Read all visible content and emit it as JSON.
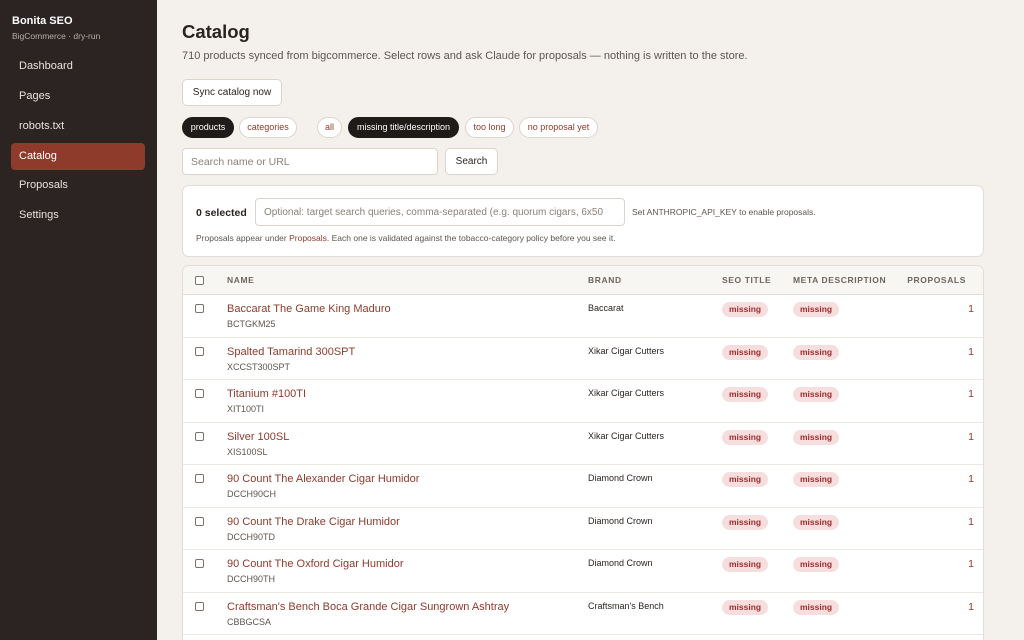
{
  "sidebar": {
    "brand": "Bonita SEO",
    "subtitle": "BigCommerce · dry-run",
    "items": [
      {
        "label": "Dashboard"
      },
      {
        "label": "Pages"
      },
      {
        "label": "robots.txt"
      },
      {
        "label": "Catalog",
        "active": true
      },
      {
        "label": "Proposals"
      },
      {
        "label": "Settings"
      }
    ]
  },
  "main": {
    "title": "Catalog",
    "description": "710 products synced from bigcommerce. Select rows and ask Claude for proposals — nothing is written to the store.",
    "sync_label": "Sync catalog now",
    "chips": [
      {
        "label": "products",
        "active": true
      },
      {
        "label": "categories",
        "active": false
      },
      {
        "label": "all",
        "active": false
      },
      {
        "label": "missing title/description",
        "active": true
      },
      {
        "label": "too long",
        "active": false
      },
      {
        "label": "no proposal yet",
        "active": false
      }
    ],
    "search_placeholder": "Search name or URL",
    "search_label": "Search"
  },
  "panel": {
    "selected": "0 selected",
    "queries_placeholder": "Optional: target search queries, comma-separated (e.g. quorum cigars, 6x50",
    "api_note": "Set ANTHROPIC_API_KEY to enable proposals.",
    "note_prefix": "Proposals appear under ",
    "note_link": "Proposals",
    "note_suffix": ". Each one is validated against the tobacco-category policy before you see it."
  },
  "table": {
    "headers": {
      "name": "NAME",
      "brand": "BRAND",
      "seo": "SEO TITLE",
      "meta": "META DESCRIPTION",
      "proposals": "PROPOSALS"
    },
    "rows": [
      {
        "name": "Baccarat The Game King Maduro",
        "sku": "BCTGKM25",
        "brand": "Baccarat",
        "seo": "missing",
        "meta": "missing",
        "proposals": "1"
      },
      {
        "name": "Spalted Tamarind 300SPT",
        "sku": "XCCST300SPT",
        "brand": "Xikar Cigar Cutters",
        "seo": "missing",
        "meta": "missing",
        "proposals": "1"
      },
      {
        "name": "Titanium #100TI",
        "sku": "XIT100TI",
        "brand": "Xikar Cigar Cutters",
        "seo": "missing",
        "meta": "missing",
        "proposals": "1"
      },
      {
        "name": "Silver 100SL",
        "sku": "XIS100SL",
        "brand": "Xikar Cigar Cutters",
        "seo": "missing",
        "meta": "missing",
        "proposals": "1"
      },
      {
        "name": "90 Count The Alexander Cigar Humidor",
        "sku": "DCCH90CH",
        "brand": "Diamond Crown",
        "seo": "missing",
        "meta": "missing",
        "proposals": "1"
      },
      {
        "name": "90 Count The Drake Cigar Humidor",
        "sku": "DCCH90TD",
        "brand": "Diamond Crown",
        "seo": "missing",
        "meta": "missing",
        "proposals": "1"
      },
      {
        "name": "90 Count The Oxford Cigar Humidor",
        "sku": "DCCH90TH",
        "brand": "Diamond Crown",
        "seo": "missing",
        "meta": "missing",
        "proposals": "1"
      },
      {
        "name": "Craftsman's Bench Boca Grande Cigar Sungrown Ashtray",
        "sku": "CBBGCSA",
        "brand": "Craftsman's Bench",
        "seo": "missing",
        "meta": "missing",
        "proposals": "1"
      }
    ]
  },
  "colors": {
    "accent": "#8e3b2c",
    "sidebar": "#2b2422",
    "badge_bg": "#f7dede",
    "badge_text": "#a12b2b"
  }
}
